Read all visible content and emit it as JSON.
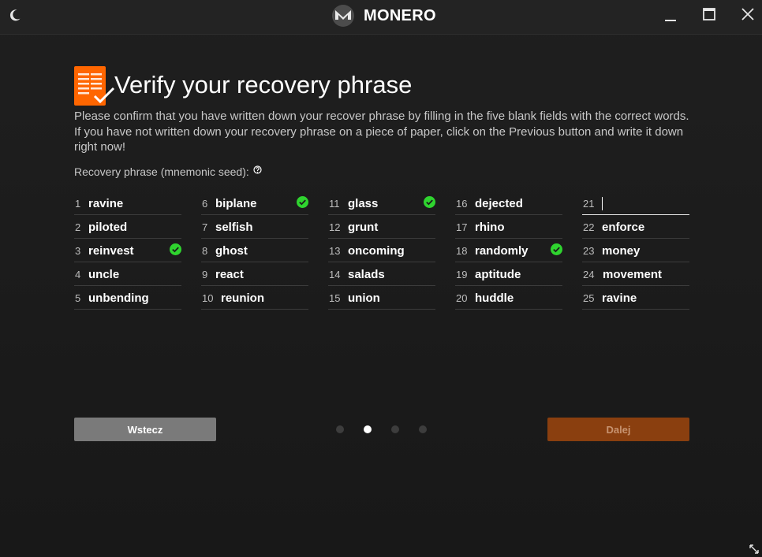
{
  "titlebar": {
    "brand": "MONERO",
    "icons": {
      "theme": "moon-icon",
      "minimize": "minimize-icon",
      "maximize": "maximize-icon",
      "close": "close-icon"
    }
  },
  "header": {
    "title": "Verify your recovery phrase",
    "description": "Please confirm that you have written down your recover phrase by filling in the five blank fields with the correct words. If you have not written down your recovery phrase on a piece of paper, click on the Previous button and write it down right now!",
    "seed_label": "Recovery phrase (mnemonic seed):"
  },
  "words": [
    {
      "n": "1",
      "w": "ravine"
    },
    {
      "n": "2",
      "w": "piloted"
    },
    {
      "n": "3",
      "w": "reinvest",
      "verified": true
    },
    {
      "n": "4",
      "w": "uncle"
    },
    {
      "n": "5",
      "w": "unbending"
    },
    {
      "n": "6",
      "w": "biplane",
      "verified": true
    },
    {
      "n": "7",
      "w": "selfish"
    },
    {
      "n": "8",
      "w": "ghost"
    },
    {
      "n": "9",
      "w": "react"
    },
    {
      "n": "10",
      "w": "reunion"
    },
    {
      "n": "11",
      "w": "glass",
      "verified": true
    },
    {
      "n": "12",
      "w": "grunt"
    },
    {
      "n": "13",
      "w": "oncoming"
    },
    {
      "n": "14",
      "w": "salads"
    },
    {
      "n": "15",
      "w": "union"
    },
    {
      "n": "16",
      "w": "dejected"
    },
    {
      "n": "17",
      "w": "rhino"
    },
    {
      "n": "18",
      "w": "randomly",
      "verified": true
    },
    {
      "n": "19",
      "w": "aptitude"
    },
    {
      "n": "20",
      "w": "huddle"
    },
    {
      "n": "21",
      "w": "",
      "input": true
    },
    {
      "n": "22",
      "w": "enforce"
    },
    {
      "n": "23",
      "w": "money"
    },
    {
      "n": "24",
      "w": "movement"
    },
    {
      "n": "25",
      "w": "ravine"
    }
  ],
  "footer": {
    "back_label": "Wstecz",
    "next_label": "Dalej",
    "steps_total": 4,
    "step_active": 2
  },
  "colors": {
    "accent": "#ff6600",
    "check": "#2fd42f",
    "next_disabled": "#8a3f0f"
  }
}
